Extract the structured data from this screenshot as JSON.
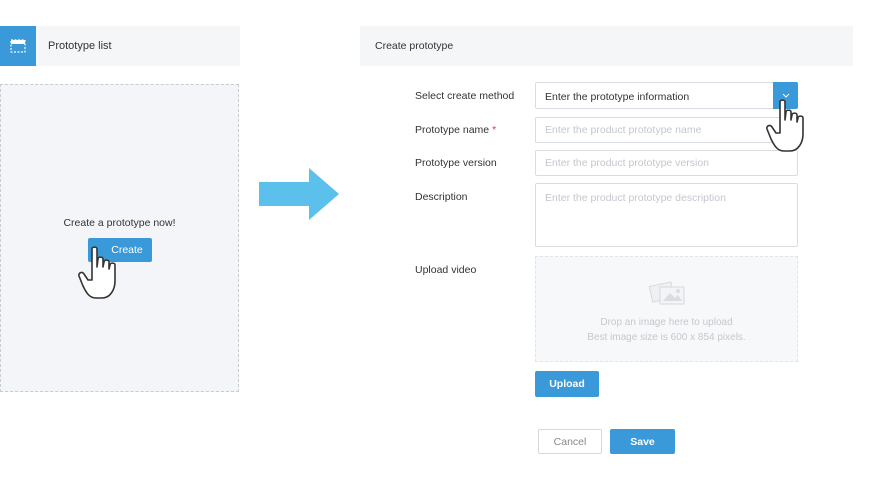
{
  "list_panel": {
    "title": "Prototype list",
    "empty_message": "Create a prototype now!",
    "create_label": "Create"
  },
  "form": {
    "title": "Create prototype",
    "method_label": "Select create method",
    "method_value": "Enter the prototype information",
    "name_label": "Prototype name",
    "required_mark": "*",
    "name_placeholder": "Enter the product prototype name",
    "version_label": "Prototype version",
    "version_placeholder": "Enter the product prototype version",
    "description_label": "Description",
    "description_placeholder": "Enter the product prototype description",
    "upload_video_label": "Upload video",
    "upload_hint_line1": "Drop an image here to upload",
    "upload_hint_line2": "Best image size is 600 x 854 pixels.",
    "upload_label": "Upload",
    "cancel_label": "Cancel",
    "save_label": "Save"
  },
  "colors": {
    "accent": "#3a99d8",
    "arrow": "#5bc0eb",
    "required": "#e03c3c"
  },
  "icons": [
    "layout-icon",
    "chevron-down-icon",
    "pointer-hand-icon",
    "image-placeholder-icon",
    "arrow-right-icon"
  ]
}
